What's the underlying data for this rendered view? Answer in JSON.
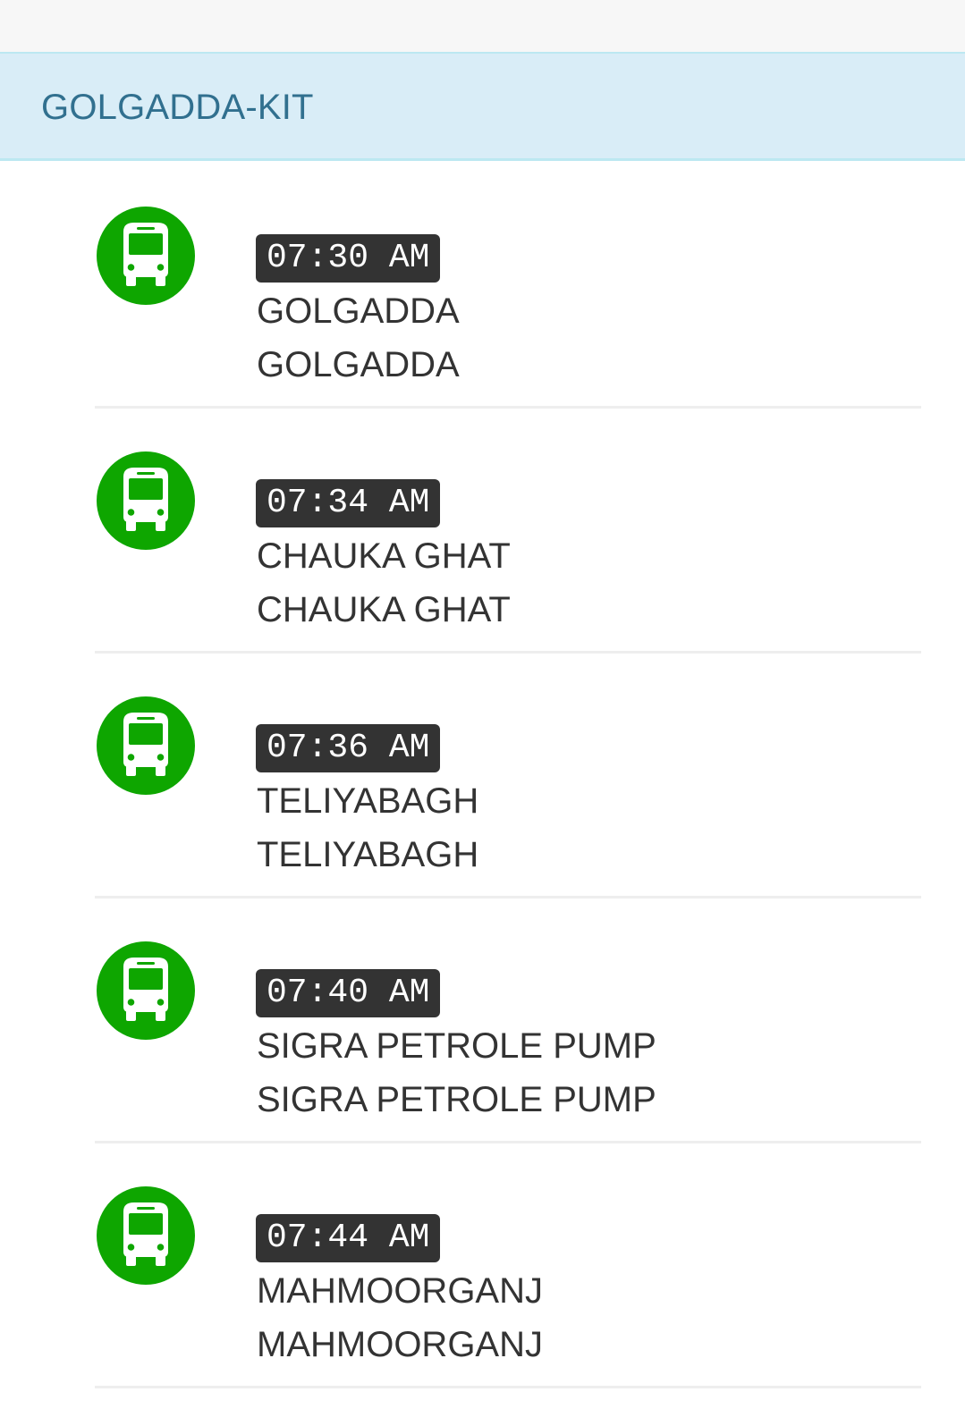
{
  "route": {
    "title": "GOLGADDA-KIT"
  },
  "icon": {
    "name": "bus-icon",
    "color": "#0ea600"
  },
  "stops": [
    {
      "time": "07:30 AM",
      "name": "GOLGADDA",
      "subname": "GOLGADDA"
    },
    {
      "time": "07:34 AM",
      "name": "CHAUKA GHAT",
      "subname": "CHAUKA GHAT"
    },
    {
      "time": "07:36 AM",
      "name": "TELIYABAGH",
      "subname": "TELIYABAGH"
    },
    {
      "time": "07:40 AM",
      "name": "SIGRA PETROLE PUMP",
      "subname": "SIGRA PETROLE PUMP"
    },
    {
      "time": "07:44 AM",
      "name": "MAHMOORGANJ",
      "subname": "MAHMOORGANJ"
    }
  ]
}
